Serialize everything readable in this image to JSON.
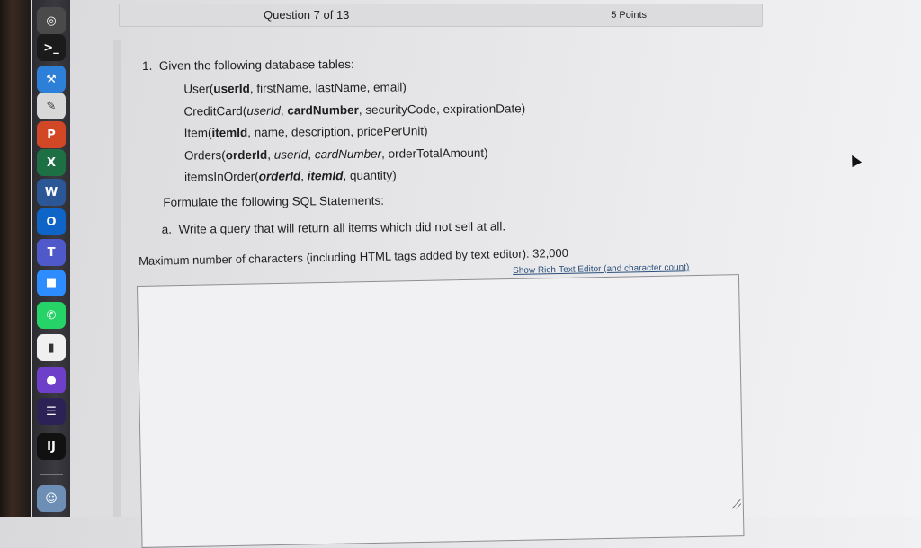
{
  "header": {
    "question_counter": "Question 7 of 13",
    "points": "5 Points"
  },
  "question": {
    "number": "1.",
    "intro": "Given the following database tables:",
    "tables": [
      {
        "name": "User(",
        "fields": [
          {
            "text": "userId",
            "bold": true,
            "italic": false
          },
          {
            "text": ", firstName, lastName, email)",
            "bold": false,
            "italic": false
          }
        ]
      },
      {
        "name": "CreditCard(",
        "fields": [
          {
            "text": "userId",
            "bold": false,
            "italic": true
          },
          {
            "text": ", ",
            "bold": false,
            "italic": false
          },
          {
            "text": "cardNumber",
            "bold": true,
            "italic": false
          },
          {
            "text": ", securityCode, expirationDate)",
            "bold": false,
            "italic": false
          }
        ]
      },
      {
        "name": "Item(",
        "fields": [
          {
            "text": "itemId",
            "bold": true,
            "italic": false
          },
          {
            "text": ", name, description, pricePerUnit)",
            "bold": false,
            "italic": false
          }
        ]
      },
      {
        "name": "Orders(",
        "fields": [
          {
            "text": "orderId",
            "bold": true,
            "italic": false
          },
          {
            "text": ", ",
            "bold": false,
            "italic": false
          },
          {
            "text": "userId",
            "bold": false,
            "italic": true
          },
          {
            "text": ", ",
            "bold": false,
            "italic": false
          },
          {
            "text": "cardNumber",
            "bold": false,
            "italic": true
          },
          {
            "text": ", orderTotalAmount)",
            "bold": false,
            "italic": false
          }
        ]
      },
      {
        "name": "itemsInOrder(",
        "fields": [
          {
            "text": "orderId",
            "bold": true,
            "italic": true
          },
          {
            "text": ", ",
            "bold": false,
            "italic": false
          },
          {
            "text": "itemId",
            "bold": true,
            "italic": true
          },
          {
            "text": ", quantity)",
            "bold": false,
            "italic": false
          }
        ]
      }
    ],
    "instruction": "Formulate the following SQL Statements:",
    "part_label": "a.",
    "part_text": "Write a query that will return all items which did not sell at all."
  },
  "answer": {
    "max_chars_text": "Maximum number of characters (including HTML tags added by text editor): 32,000",
    "rich_text_link": "Show Rich-Text Editor (and character count)",
    "value": ""
  },
  "dock": {
    "icons": [
      {
        "name": "chrome-icon",
        "glyph": "◎",
        "color": "#4a4a4a"
      },
      {
        "name": "terminal-icon",
        "glyph": ">_",
        "color": "#1b1b1b"
      },
      {
        "name": "xcode-icon",
        "glyph": "⚒",
        "color": "#2d7fd8"
      },
      {
        "name": "textedit-icon",
        "glyph": "✎",
        "color": "#d8d8d8"
      },
      {
        "name": "powerpoint-icon",
        "glyph": "P",
        "color": "#d24726"
      },
      {
        "name": "excel-icon",
        "glyph": "X",
        "color": "#1d7044"
      },
      {
        "name": "word-icon",
        "glyph": "W",
        "color": "#2b5797"
      },
      {
        "name": "outlook-icon",
        "glyph": "O",
        "color": "#0f64c8"
      },
      {
        "name": "teams-icon",
        "glyph": "T",
        "color": "#5059c9"
      },
      {
        "name": "zoom-icon",
        "glyph": "■",
        "color": "#2d8cff"
      },
      {
        "name": "whatsapp-icon",
        "glyph": "✆",
        "color": "#25d366"
      },
      {
        "name": "chart-app-icon",
        "glyph": "▮",
        "color": "#f0f0f0"
      },
      {
        "name": "github-icon",
        "glyph": "●",
        "color": "#6e40c9"
      },
      {
        "name": "eclipse-icon",
        "glyph": "☰",
        "color": "#2c2255"
      },
      {
        "name": "intellij-icon",
        "glyph": "IJ",
        "color": "#111111"
      },
      {
        "name": "finder-icon",
        "glyph": "☺",
        "color": "#6d8fb5"
      }
    ]
  }
}
